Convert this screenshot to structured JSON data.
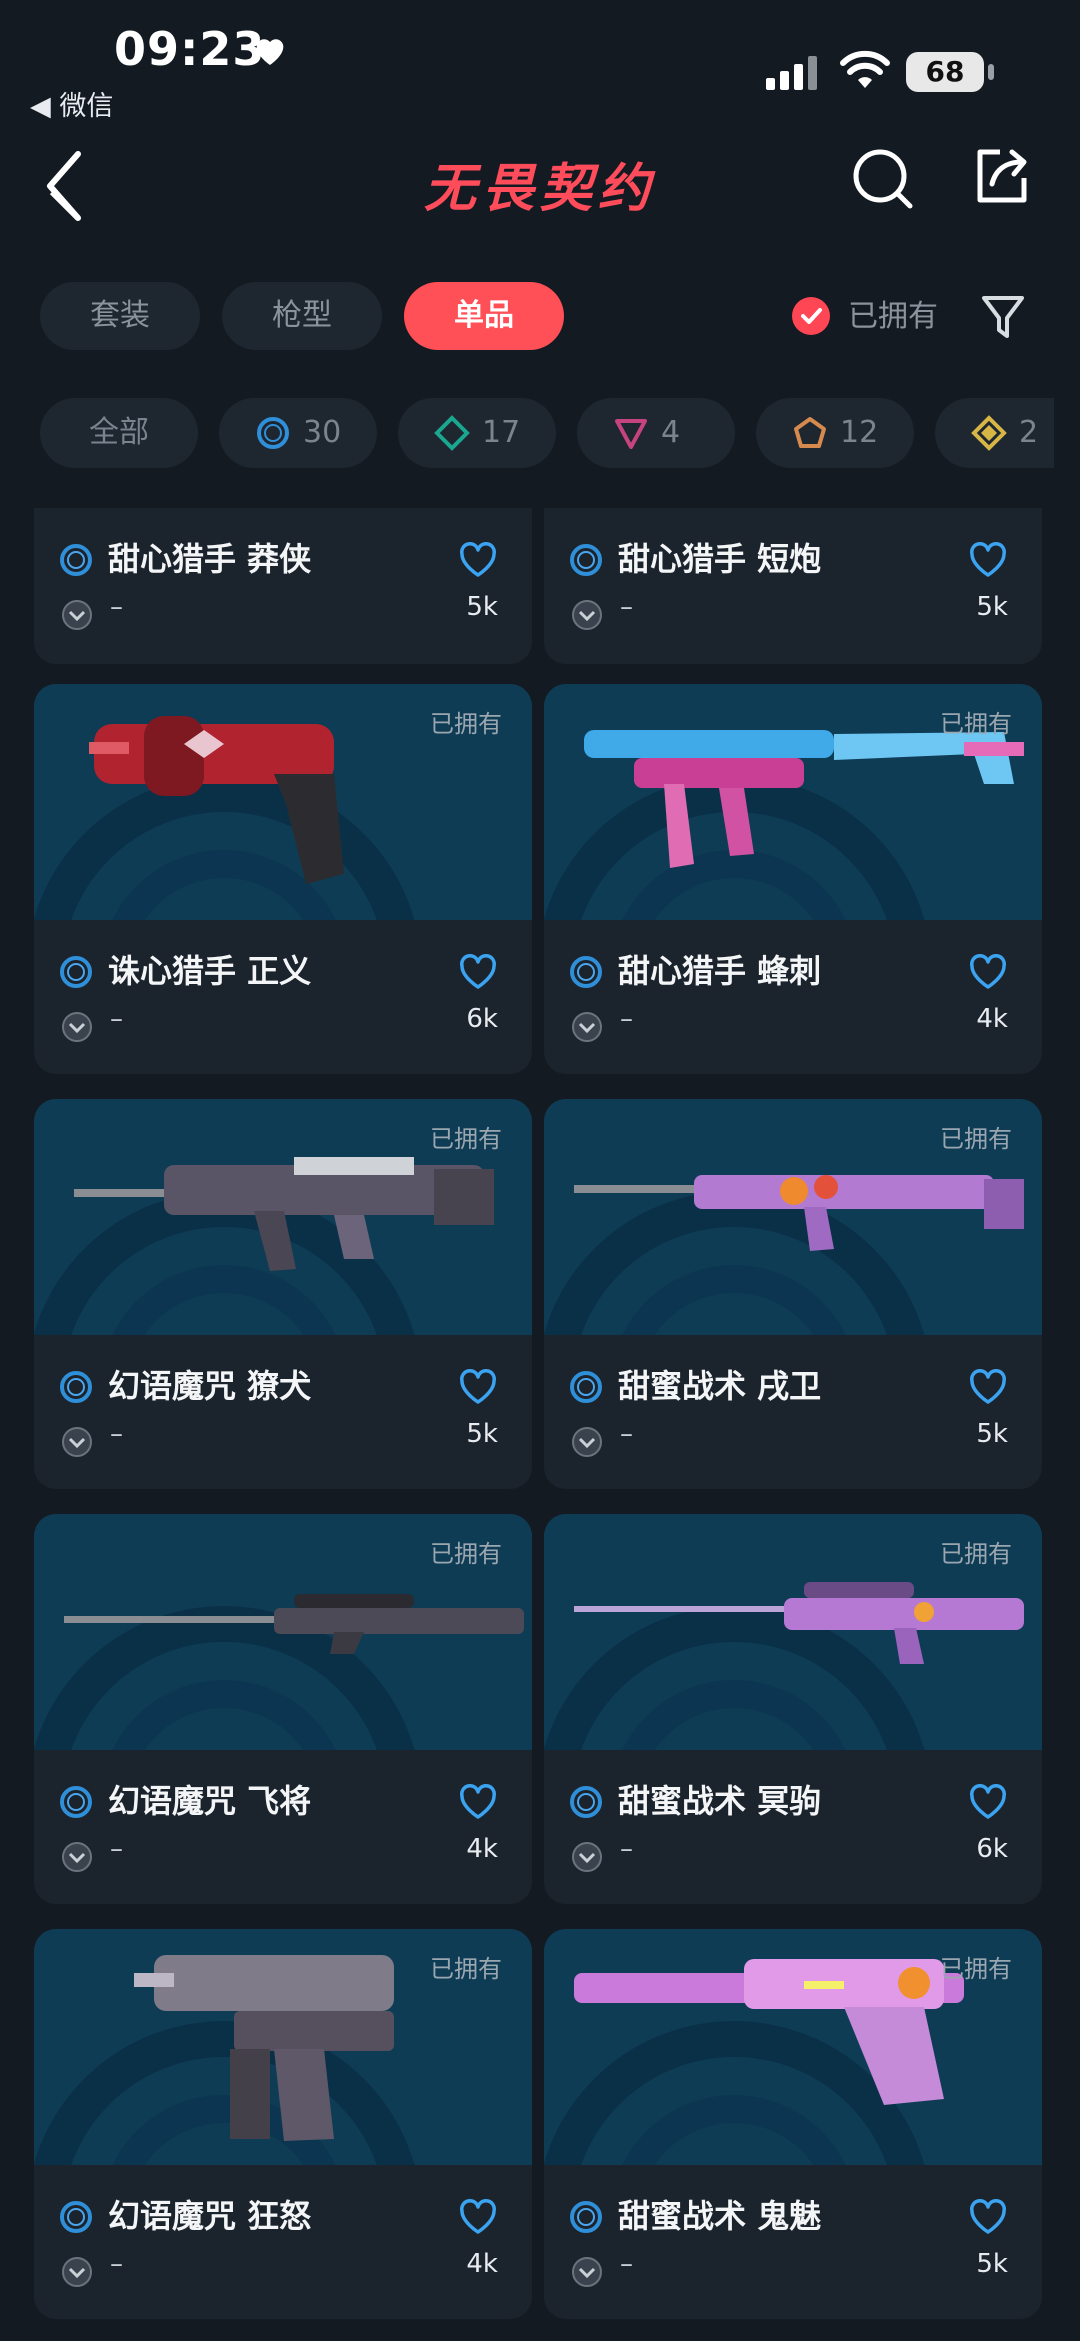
{
  "status_bar": {
    "time": "09:23",
    "back_app": "◀ 微信",
    "battery": "68"
  },
  "nav": {
    "title": "无畏契约"
  },
  "tabs": [
    {
      "label": "套装",
      "active": false
    },
    {
      "label": "枪型",
      "active": false
    },
    {
      "label": "单品",
      "active": true
    }
  ],
  "owned_filter": {
    "label": "已拥有",
    "checked": true
  },
  "rarity_chips": [
    {
      "label": "全部",
      "icon": "none"
    },
    {
      "label": "30",
      "icon": "select-circle-icon",
      "color": "#2f8fd8"
    },
    {
      "label": "17",
      "icon": "deluxe-diamond-icon",
      "color": "#1aa68f"
    },
    {
      "label": "4",
      "icon": "premium-triangle-icon",
      "color": "#c5437e"
    },
    {
      "label": "12",
      "icon": "exclusive-pentagon-icon",
      "color": "#d68a4e"
    },
    {
      "label": "2",
      "icon": "ultra-diamond-icon",
      "color": "#d8b646"
    }
  ],
  "cards": [
    {
      "name": "甜心猎手 莽侠",
      "level": "–",
      "likes": "5k",
      "owned": "",
      "weapon": "none"
    },
    {
      "name": "甜心猎手 短炮",
      "level": "–",
      "likes": "5k",
      "owned": "",
      "weapon": "none"
    },
    {
      "name": "诛心猎手 正义",
      "level": "–",
      "likes": "6k",
      "owned": "已拥有",
      "weapon": "revolver"
    },
    {
      "name": "甜心猎手 蜂刺",
      "level": "–",
      "likes": "4k",
      "owned": "已拥有",
      "weapon": "smg"
    },
    {
      "name": "幻语魔咒 獠犬",
      "level": "–",
      "likes": "5k",
      "owned": "已拥有",
      "weapon": "rifle-bullpup"
    },
    {
      "name": "甜蜜战术 戌卫",
      "level": "–",
      "likes": "5k",
      "owned": "已拥有",
      "weapon": "rifle-long"
    },
    {
      "name": "幻语魔咒 飞将",
      "level": "–",
      "likes": "4k",
      "owned": "已拥有",
      "weapon": "sniper-lever"
    },
    {
      "name": "甜蜜战术 冥驹",
      "level": "–",
      "likes": "6k",
      "owned": "已拥有",
      "weapon": "sniper"
    },
    {
      "name": "幻语魔咒 狂怒",
      "level": "–",
      "likes": "4k",
      "owned": "已拥有",
      "weapon": "machine-pistol"
    },
    {
      "name": "甜蜜战术 鬼魅",
      "level": "–",
      "likes": "5k",
      "owned": "已拥有",
      "weapon": "pistol"
    }
  ],
  "colors": {
    "accent": "#ff4f57",
    "select_blue": "#2f8fd8",
    "card_bg": "#1b232c",
    "image_bg": "#0f3c55"
  }
}
